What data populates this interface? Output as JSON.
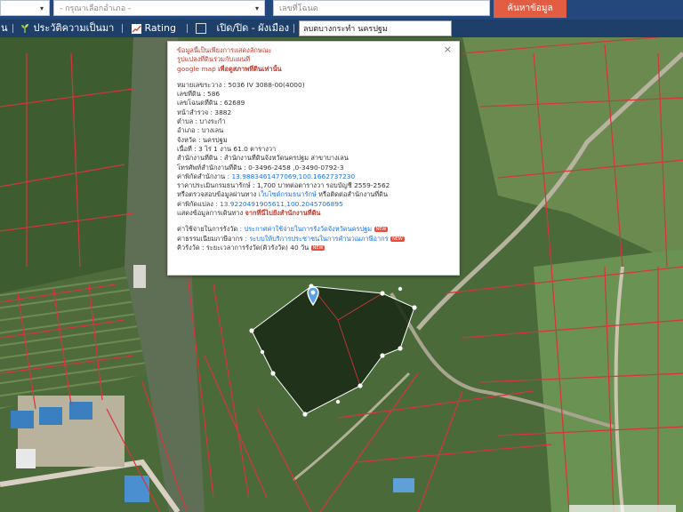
{
  "header": {
    "province_select": {
      "caret": "▾"
    },
    "district_select": {
      "placeholder": "- กรุณาเลือกอำเภอ -",
      "caret": "▾"
    },
    "deed_input": {
      "placeholder": "เลขที่โฉนด"
    },
    "search_button": "ค้นหาข้อมูล"
  },
  "toolbar": {
    "item_partial": "น",
    "history": "ประวัติความเป็นมา",
    "rating": "Rating",
    "layer_toggle": "เปิด/ปิด - ผังเมือง",
    "address": "ลบตบางกระทำ นครปฐม"
  },
  "popup": {
    "notice_1": "ข้อมูลนี้เป็นเพียงการแสดงลักษณะ",
    "notice_2": "รูปแปลงที่ดินร่วมกับแผนที่",
    "notice_3a": "google map ",
    "notice_3b": "เพื่อดูสภาพที่ดินเท่านั้น",
    "fields": [
      {
        "label": "หมายเลขระวาง",
        "value": " : 5036 IV 3088-00(4000)"
      },
      {
        "label": "เลขที่ดิน",
        "value": " : 586"
      },
      {
        "label": "เลขโฉนดที่ดิน",
        "value": " : 62689"
      },
      {
        "label": "หน้าสำรวจ",
        "value": " : 3882"
      },
      {
        "label": "ตำบล",
        "value": " : บางระกำ"
      },
      {
        "label": "อำเภอ",
        "value": " : บางเลน"
      },
      {
        "label": "จังหวัด",
        "value": " : นครปฐม"
      },
      {
        "label": "เนื้อที่",
        "value": " : 3 ไร่ 1 งาน 61.0 ตารางวา"
      },
      {
        "label": "สำนักงานที่ดิน",
        "value": " : สำนักงานที่ดินจังหวัดนครปฐม สาขาบางเลน"
      },
      {
        "label": "โทรศัพท์สำนักงานที่ดิน",
        "value": " : 0-3496-2458 ,0-3490-0792-3"
      }
    ],
    "office_coord_label": "ค่าพิกัดสำนักงาน",
    "office_coord_value": " : 13.9883461477069,100.1662737230",
    "price_label": "ราคาประเมินกรมธนารักษ์",
    "price_value": " : 1,700 บาทต่อตารางวา รอบบัญชี 2559-2562",
    "check_label": "หรือตรวจสอบข้อมูลผ่านทาง ",
    "check_link": "เว็บไซต์กรมธนารักษ์",
    "check_suffix": " หรือติดต่อสำนักงานที่ดิน",
    "parcel_coord_label": "ค่าพิกัดแปลง",
    "parcel_coord_value": " : 13.9220491905611,100.2045706895",
    "route_label": "แสดงข้อมูลการเดินทาง ",
    "route_link": "จากที่นี่ไปยังสำนักงานที่ดิน",
    "fee_label": "ค่าใช้จ่ายในการรังวัด",
    "fee_value": " : ประกาศค่าใช้จ่ายในการรังวัดจังหวัดนครปฐม",
    "fee_badge": "NEW",
    "duration_label": "ค่าธรรมเนียมภาษีอากร",
    "duration_value": " : ระบบให้บริการประชาชนในการคำนวณภาษีอากร",
    "duration_badge": "NEW",
    "survey_label": "คิวรังวัด",
    "survey_value": " : ระยะเวลาการรังวัด(คิวรังวัด) 40 วัน",
    "survey_badge": "NEW",
    "close": "×"
  },
  "map": {
    "colors": {
      "boundary": "#d9333b",
      "parcel": "#1a2a14",
      "vertex": "#ffffff"
    },
    "pin_icon": "location-pin-icon"
  }
}
